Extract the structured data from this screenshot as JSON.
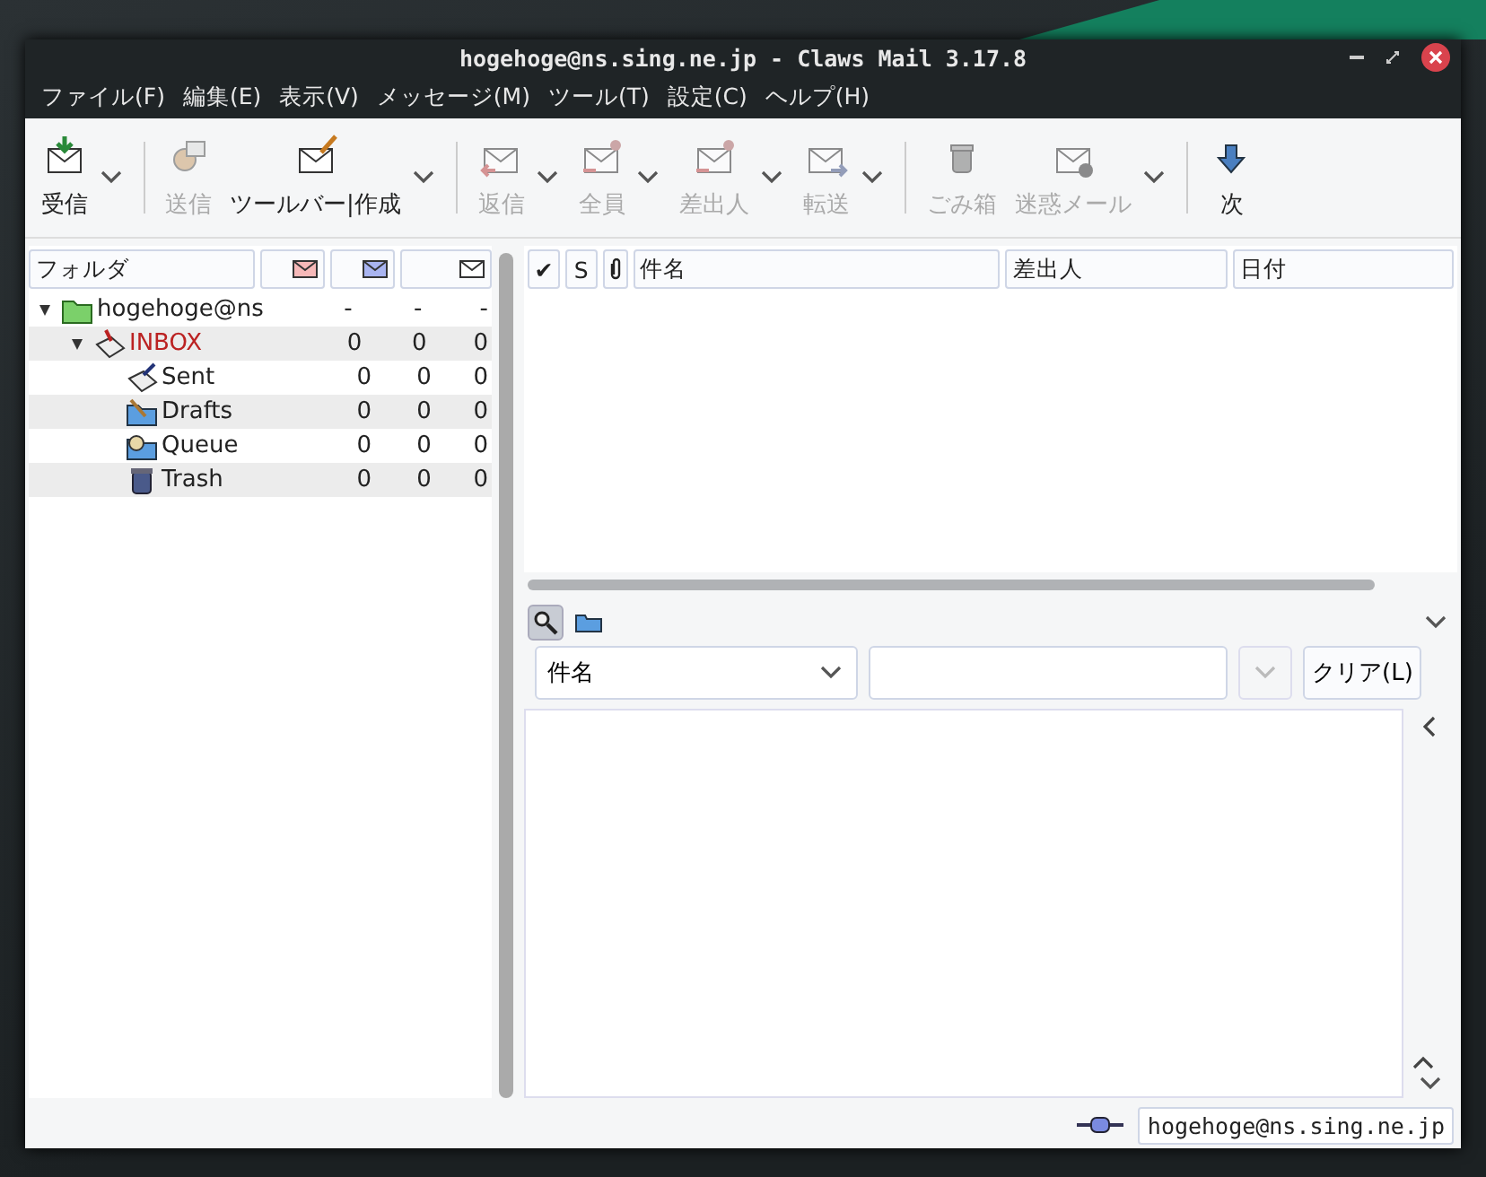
{
  "window": {
    "title": "hogehoge@ns.sing.ne.jp - Claws Mail 3.17.8"
  },
  "menu": [
    "ファイル(F)",
    "編集(E)",
    "表示(V)",
    "メッセージ(M)",
    "ツール(T)",
    "設定(C)",
    "ヘルプ(H)"
  ],
  "toolbar": [
    {
      "kind": "receive",
      "label": "受信",
      "disabled": false,
      "menu": true
    },
    {
      "kind": "separator"
    },
    {
      "kind": "send",
      "label": "送信",
      "disabled": true,
      "menu": false
    },
    {
      "kind": "compose",
      "label": "ツールバー|作成",
      "disabled": false,
      "menu": true
    },
    {
      "kind": "separator"
    },
    {
      "kind": "reply",
      "label": "返信",
      "disabled": true,
      "menu": true
    },
    {
      "kind": "replyall",
      "label": "全員",
      "disabled": true,
      "menu": true
    },
    {
      "kind": "replysender",
      "label": "差出人",
      "disabled": true,
      "menu": true
    },
    {
      "kind": "forward",
      "label": "転送",
      "disabled": true,
      "menu": true
    },
    {
      "kind": "separator"
    },
    {
      "kind": "trash",
      "label": "ごみ箱",
      "disabled": true,
      "menu": false
    },
    {
      "kind": "spam",
      "label": "迷惑メール",
      "disabled": true,
      "menu": true
    },
    {
      "kind": "separator"
    },
    {
      "kind": "next",
      "label": "次",
      "disabled": false,
      "menu": false
    }
  ],
  "folders": {
    "header": "フォルダ",
    "tree": [
      {
        "name": "hogehoge@ns",
        "kind": "account",
        "expanded": true,
        "counts": [
          "-",
          "-",
          "-"
        ],
        "children": [
          {
            "name": "INBOX",
            "kind": "inbox",
            "expanded": true,
            "counts": [
              "0",
              "0",
              "0"
            ],
            "children": [
              {
                "name": "Sent",
                "kind": "sent",
                "counts": [
                  "0",
                  "0",
                  "0"
                ]
              },
              {
                "name": "Drafts",
                "kind": "drafts",
                "counts": [
                  "0",
                  "0",
                  "0"
                ]
              },
              {
                "name": "Queue",
                "kind": "queue",
                "counts": [
                  "0",
                  "0",
                  "0"
                ]
              },
              {
                "name": "Trash",
                "kind": "trash",
                "counts": [
                  "0",
                  "0",
                  "0"
                ]
              }
            ]
          }
        ]
      }
    ]
  },
  "messages": {
    "columns": [
      {
        "kind": "text",
        "label": "✔"
      },
      {
        "kind": "text",
        "label": "S"
      },
      {
        "kind": "attachment"
      },
      {
        "kind": "text",
        "label": "件名"
      },
      {
        "kind": "text",
        "label": "差出人"
      },
      {
        "kind": "text",
        "label": "日付"
      }
    ]
  },
  "search": {
    "search_toggle": {
      "selected": true
    },
    "field": "件名",
    "clear_button": "クリア(L)"
  },
  "status_bar": {
    "account": "hogehoge@ns.sing.ne.jp"
  }
}
